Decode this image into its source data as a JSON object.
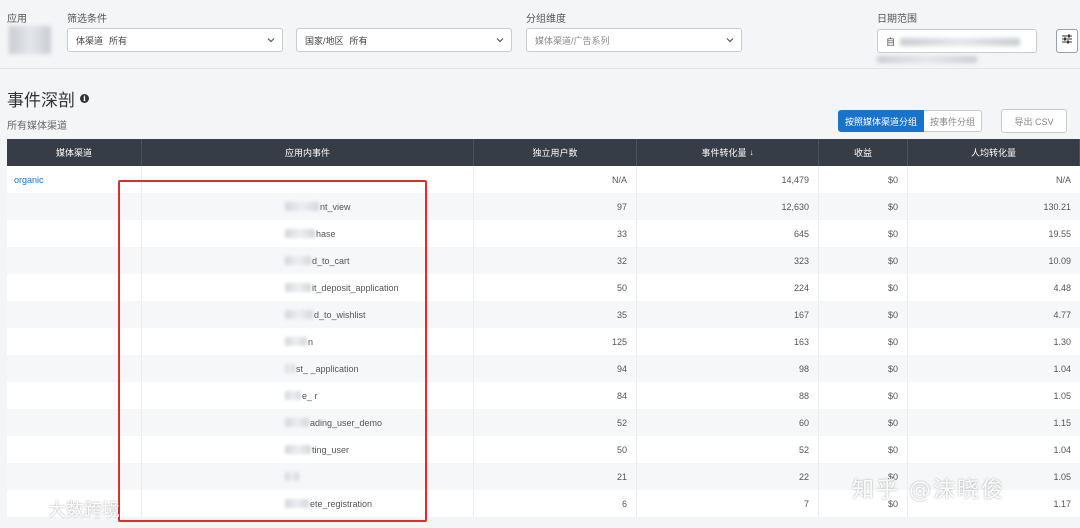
{
  "filters": {
    "app_label": "应用",
    "filter_label": "筛选条件",
    "group_label": "分组维度",
    "date_label": "日期范围",
    "media_select": {
      "prefix": "体渠道",
      "value": "所有"
    },
    "country_select": {
      "prefix": "国家/地区",
      "value": "所有"
    },
    "group_select": {
      "value": "媒体渠道/广告系列"
    },
    "date_value": "自"
  },
  "section": {
    "title": "事件深剖",
    "subtitle": "所有媒体渠道"
  },
  "toolbar": {
    "group_by_media": "按照媒体渠道分组",
    "group_by_event": "按事件分组",
    "export": "导出 CSV"
  },
  "table": {
    "headers": [
      "媒体渠道",
      "应用内事件",
      "独立用户数",
      "事件转化量",
      "收益",
      "人均转化量"
    ],
    "sort_indicator": "↓",
    "rows": [
      {
        "channel": "organic",
        "event": "",
        "users": "N/A",
        "conversions": "14,479",
        "revenue": "$0",
        "per_user": "N/A"
      },
      {
        "channel": "",
        "event": "nt_view",
        "users": "97",
        "conversions": "12,630",
        "revenue": "$0",
        "per_user": "130.21"
      },
      {
        "channel": "",
        "event": "hase",
        "users": "33",
        "conversions": "645",
        "revenue": "$0",
        "per_user": "19.55"
      },
      {
        "channel": "",
        "event": "d_to_cart",
        "users": "32",
        "conversions": "323",
        "revenue": "$0",
        "per_user": "10.09"
      },
      {
        "channel": "",
        "event": "it_deposit_application",
        "users": "50",
        "conversions": "224",
        "revenue": "$0",
        "per_user": "4.48"
      },
      {
        "channel": "",
        "event": "d_to_wishlist",
        "users": "35",
        "conversions": "167",
        "revenue": "$0",
        "per_user": "4.77"
      },
      {
        "channel": "",
        "event": "n",
        "users": "125",
        "conversions": "163",
        "revenue": "$0",
        "per_user": "1.30"
      },
      {
        "channel": "",
        "event": "st_ _application",
        "users": "94",
        "conversions": "98",
        "revenue": "$0",
        "per_user": "1.04"
      },
      {
        "channel": "",
        "event": "e_ r",
        "users": "84",
        "conversions": "88",
        "revenue": "$0",
        "per_user": "1.05"
      },
      {
        "channel": "",
        "event": "ading_user_demo",
        "users": "52",
        "conversions": "60",
        "revenue": "$0",
        "per_user": "1.15"
      },
      {
        "channel": "",
        "event": "ting_user",
        "users": "50",
        "conversions": "52",
        "revenue": "$0",
        "per_user": "1.04"
      },
      {
        "channel": "",
        "event": "",
        "users": "21",
        "conversions": "22",
        "revenue": "$0",
        "per_user": "1.05"
      },
      {
        "channel": "",
        "event": "ete_registration",
        "users": "6",
        "conversions": "7",
        "revenue": "$0",
        "per_user": "1.17"
      }
    ]
  },
  "watermarks": {
    "zhihu": "知乎 @沫晓俊",
    "brand": "大数跨境"
  },
  "colors": {
    "accent": "#1a73c8",
    "header_bg": "#363d47",
    "highlight": "#d8302a"
  }
}
